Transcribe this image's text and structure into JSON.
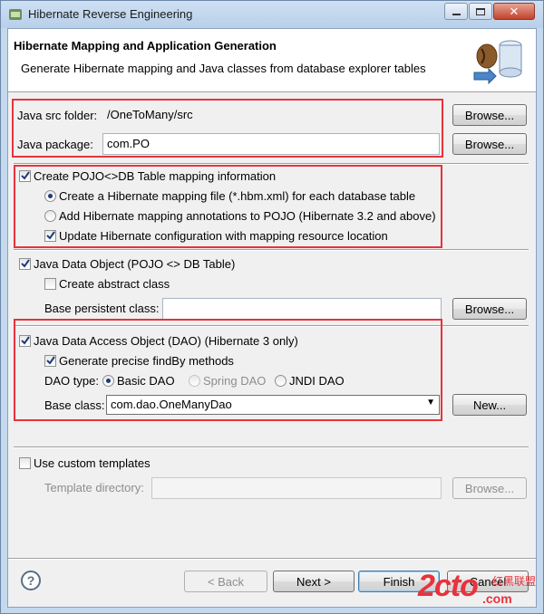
{
  "window": {
    "title": "Hibernate Reverse Engineering"
  },
  "banner": {
    "title": "Hibernate Mapping and Application Generation",
    "description": "Generate Hibernate mapping and Java classes from database explorer tables"
  },
  "source": {
    "src_folder_label": "Java src folder:",
    "src_folder_value": "/OneToMany/src",
    "package_label": "Java package:",
    "package_value": "com.PO",
    "browse_label": "Browse..."
  },
  "mapping": {
    "create_label": "Create POJO<>DB Table mapping information",
    "create_checked": true,
    "option_file": "Create a Hibernate mapping file (*.hbm.xml) for each database table",
    "option_annotations": "Add Hibernate mapping annotations to POJO (Hibernate 3.2 and above)",
    "update_config": "Update Hibernate configuration with mapping resource location"
  },
  "data_object": {
    "label": "Java Data Object (POJO <> DB Table)",
    "abstract_label": "Create abstract class",
    "base_persistent_label": "Base persistent class:",
    "base_persistent_value": ""
  },
  "dao": {
    "label": "Java Data Access Object (DAO) (Hibernate 3 only)",
    "precise_label": "Generate precise findBy methods",
    "type_label": "DAO type:",
    "types": [
      "Basic DAO",
      "Spring DAO",
      "JNDI DAO"
    ],
    "selected_type": "Basic DAO",
    "base_class_label": "Base class:",
    "base_class_value": "com.dao.OneManyDao",
    "new_label": "New..."
  },
  "templates": {
    "use_custom_label": "Use custom templates",
    "directory_label": "Template directory:"
  },
  "footer": {
    "back_label": "< Back",
    "next_label": "Next >",
    "finish_label": "Finish",
    "cancel_label": "Cancel"
  },
  "watermark": {
    "logo_text": "2cto",
    "site_text": ".com",
    "cn_text": "红黑联盟"
  },
  "colors": {
    "highlight_box": "#e8323c",
    "window_frame": "#c4d8ee"
  }
}
